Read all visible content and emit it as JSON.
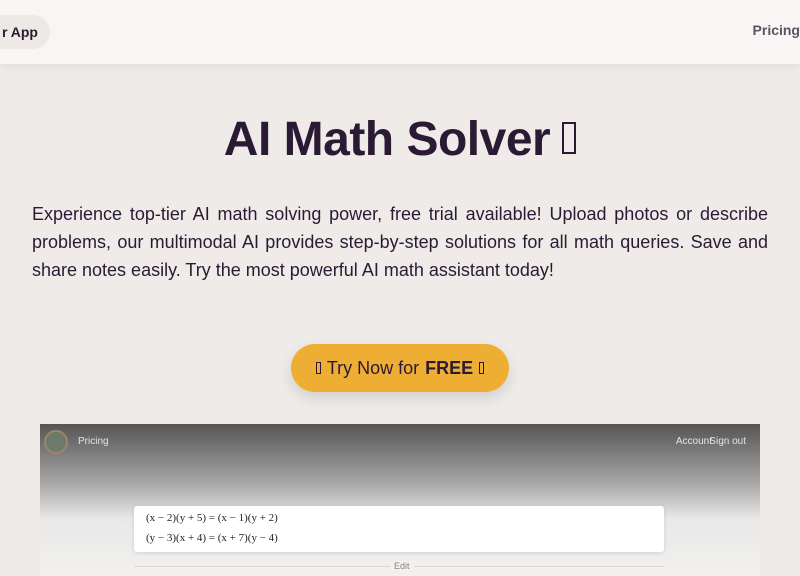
{
  "header": {
    "app_label": "r App",
    "nav_pricing": "Pricing"
  },
  "hero": {
    "title": "AI Math Solver",
    "description": "Experience top-tier AI math solving power, free trial available! Upload photos or describe problems, our multimodal AI provides step-by-step solutions for all math queries. Save and share notes easily. Try the most powerful AI math assistant today!",
    "cta_prefix": "Try Now for",
    "cta_emphasis": "FREE"
  },
  "preview": {
    "nav_pricing": "Pricing",
    "nav_account": "Account",
    "nav_signout": "Sign out",
    "equations": [
      "(x − 2)(y + 5) = (x − 1)(y + 2)",
      "(y − 3)(x + 4) = (x + 7)(y − 4)"
    ],
    "edit_label": "Edit"
  },
  "colors": {
    "background": "#eeebe8",
    "topbar": "#f7f6f4",
    "text": "#2a1a33",
    "cta": "#eeae33"
  }
}
